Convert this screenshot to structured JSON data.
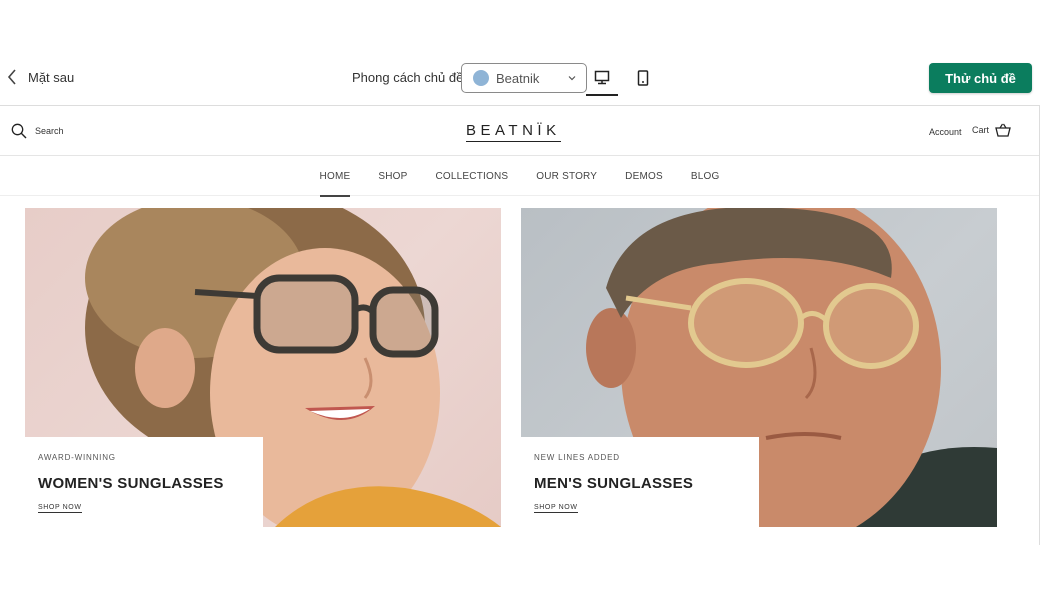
{
  "toolbar": {
    "back_label": "Mặt sau",
    "style_label": "Phong cách chủ đề",
    "theme_value": "Beatnik",
    "theme_dot_color": "#8fb4d6",
    "try_button": "Thử chủ đề",
    "try_button_color": "#0b7d5e",
    "selected_device": "desktop"
  },
  "store": {
    "search_label": "Search",
    "logo": "BEATNÏK",
    "account_label": "Account",
    "cart_label": "Cart"
  },
  "nav": {
    "items": [
      "HOME",
      "SHOP",
      "COLLECTIONS",
      "OUR STORY",
      "DEMOS",
      "BLOG"
    ],
    "active": "HOME"
  },
  "tiles": [
    {
      "eyebrow": "AWARD-WINNING",
      "headline": "WOMEN'S SUNGLASSES",
      "cta": "SHOP NOW"
    },
    {
      "eyebrow": "NEW LINES ADDED",
      "headline": "MEN'S SUNGLASSES",
      "cta": "SHOP NOW"
    }
  ]
}
